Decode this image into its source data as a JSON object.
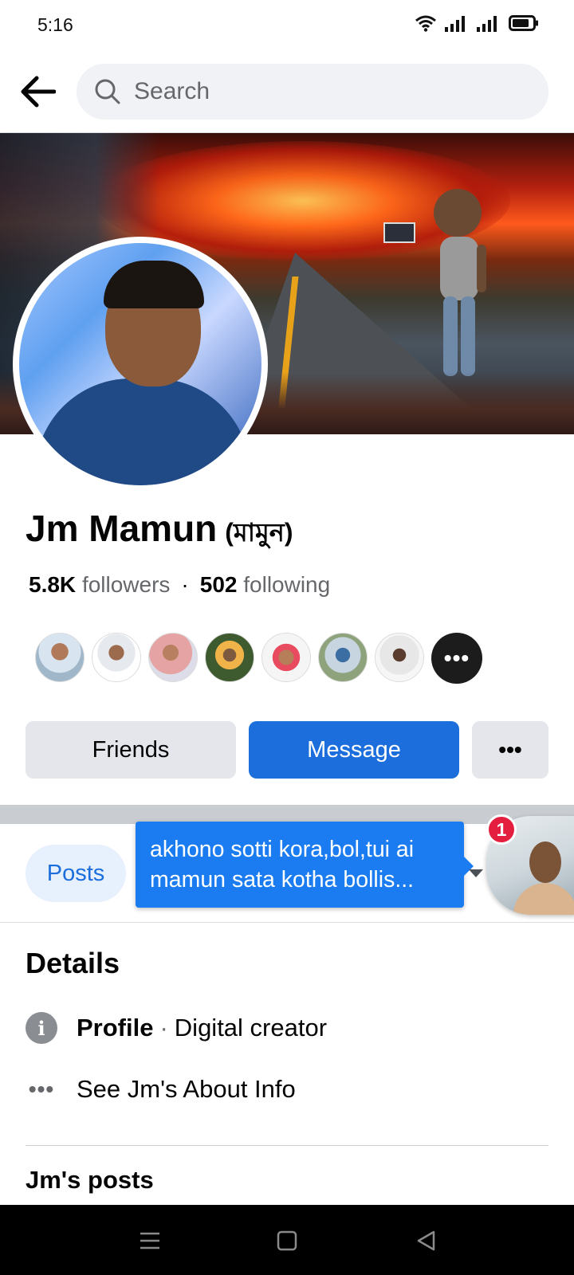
{
  "status_bar": {
    "time": "5:16"
  },
  "search": {
    "placeholder": "Search"
  },
  "profile": {
    "name": "Jm Mamun",
    "alt_name": "(মামুন)",
    "followers_count": "5.8K",
    "followers_label": "followers",
    "following_count": "502",
    "following_label": "following"
  },
  "actions": {
    "friends_label": "Friends",
    "message_label": "Message",
    "more_label": "•••"
  },
  "friends_more_label": "•••",
  "tabs": {
    "posts_label": "Posts"
  },
  "chat_head": {
    "message_line1": "akhono sotti kora,bol,tui ai",
    "message_line2": "mamun sata kotha bollis...",
    "unread_count": "1"
  },
  "details": {
    "title": "Details",
    "profile_label": "Profile",
    "profile_separator": "·",
    "profile_value": "Digital creator",
    "about_link": "See Jm's About Info"
  },
  "posts_section": {
    "heading": "Jm's posts"
  },
  "colors": {
    "accent": "#1b6edc",
    "chat_bubble": "#1a7cf0",
    "badge": "#e41e3f",
    "button_gray": "#e4e6eb"
  },
  "icons": [
    "wifi-icon",
    "signal-icon",
    "battery-icon",
    "back-arrow-icon",
    "search-icon",
    "info-icon",
    "more-dots-icon",
    "menu-nav-icon",
    "home-nav-icon",
    "back-nav-icon"
  ]
}
